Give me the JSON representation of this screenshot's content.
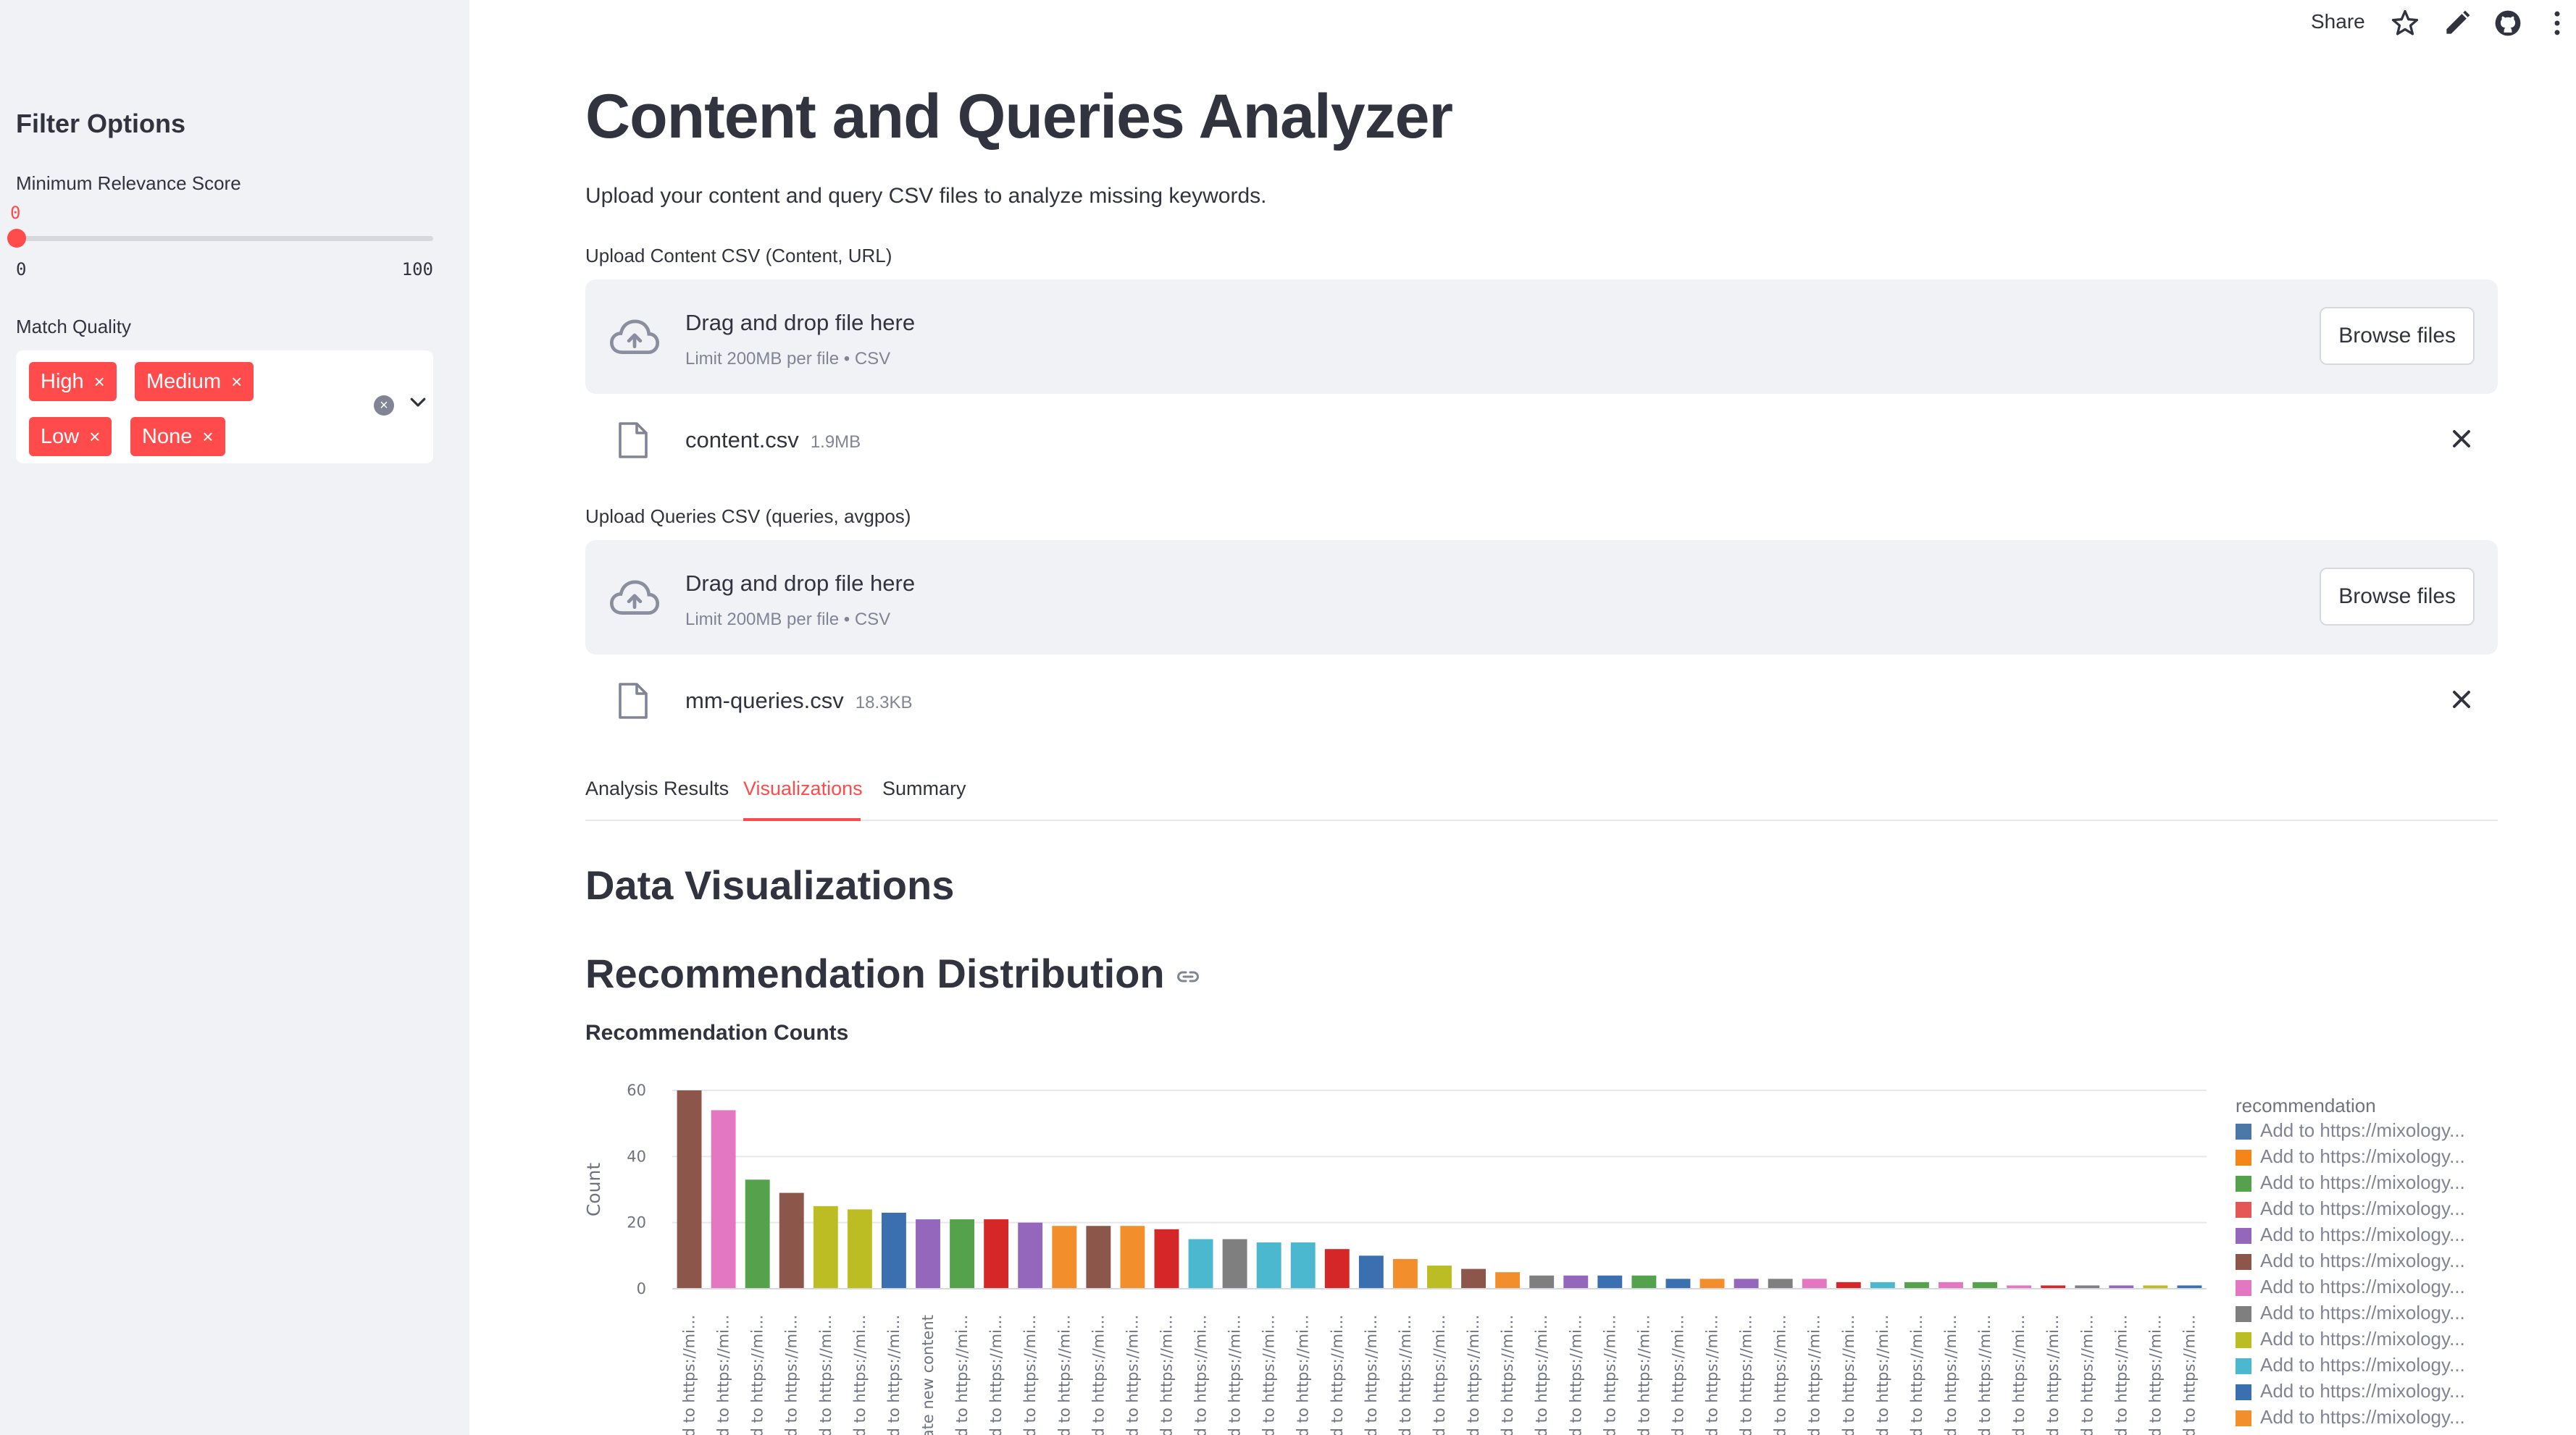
{
  "toolbar": {
    "share_label": "Share",
    "icons": [
      "star-icon",
      "edit-icon",
      "github-icon",
      "more-icon"
    ]
  },
  "sidebar": {
    "title": "Filter Options",
    "min_score": {
      "label": "Minimum Relevance Score",
      "value": "0",
      "min": "0",
      "max": "100"
    },
    "match_quality": {
      "label": "Match Quality",
      "chips": [
        "High",
        "Medium",
        "Low",
        "None"
      ],
      "chip_remove": "×"
    }
  },
  "main": {
    "title": "Content and Queries Analyzer",
    "intro": "Upload your content and query CSV files to analyze missing keywords.",
    "content_upload": {
      "label": "Upload Content CSV (Content, URL)",
      "drop_title": "Drag and drop file here",
      "drop_sub": "Limit 200MB per file • CSV",
      "browse": "Browse files",
      "file_name": "content.csv",
      "file_size": "1.9MB"
    },
    "queries_upload": {
      "label": "Upload Queries CSV (queries, avgpos)",
      "drop_title": "Drag and drop file here",
      "drop_sub": "Limit 200MB per file • CSV",
      "browse": "Browse files",
      "file_name": "mm-queries.csv",
      "file_size": "18.3KB"
    },
    "tabs": [
      {
        "label": "Analysis Results"
      },
      {
        "label": "Visualizations"
      },
      {
        "label": "Summary"
      }
    ],
    "active_tab": "Visualizations",
    "section_title": "Data Visualizations",
    "subsection_title": "Recommendation Distribution",
    "chart_title": "Recommendation Counts"
  },
  "legend": {
    "title": "recommendation",
    "items": [
      {
        "label": "Add to https://mixology...",
        "color": "#4c78a8"
      },
      {
        "label": "Add to https://mixology...",
        "color": "#f58518"
      },
      {
        "label": "Add to https://mixology...",
        "color": "#54a24b"
      },
      {
        "label": "Add to https://mixology...",
        "color": "#e45756"
      },
      {
        "label": "Add to https://mixology...",
        "color": "#9467bd"
      },
      {
        "label": "Add to https://mixology...",
        "color": "#8c564b"
      },
      {
        "label": "Add to https://mixology...",
        "color": "#e377c2"
      },
      {
        "label": "Add to https://mixology...",
        "color": "#7f7f7f"
      },
      {
        "label": "Add to https://mixology...",
        "color": "#bcbd22"
      },
      {
        "label": "Add to https://mixology...",
        "color": "#4bb8d0"
      },
      {
        "label": "Add to https://mixology...",
        "color": "#3a6fb0"
      },
      {
        "label": "Add to https://mixology...",
        "color": "#f28e2b"
      }
    ]
  },
  "chart_data": {
    "type": "bar",
    "title": "Recommendation Counts",
    "ylabel": "Count",
    "xlabel": "",
    "ylim": [
      0,
      60
    ],
    "yticks": [
      0,
      20,
      40,
      60
    ],
    "grid": true,
    "legend_title": "recommendation",
    "legend_position": "right",
    "categories": [
      "d to https://mi...",
      "d to https://mi...",
      "d to https://mi...",
      "d to https://mi...",
      "d to https://mi...",
      "d to https://mi...",
      "d to https://mi...",
      "eate new content",
      "d to https://mi...",
      "d to https://mi...",
      "d to https://mi...",
      "d to https://mi...",
      "d to https://mi...",
      "d to https://mi...",
      "d to https://mi...",
      "d to https://mi...",
      "d to https://mi...",
      "d to https://mi...",
      "d to https://mi...",
      "d to https://mi...",
      "d to https://mi...",
      "d to https://mi...",
      "d to https://mi...",
      "d to https://mi...",
      "d to https://mi...",
      "d to https://mi...",
      "d to https://mi...",
      "d to https://mi...",
      "d to https://mi...",
      "d to https://mi...",
      "d to https://mi...",
      "d to https://mi...",
      "d to https://mi...",
      "d to https://mi...",
      "d to https://mi...",
      "d to https://mi...",
      "d to https://mi...",
      "d to https://mi...",
      "d to https://mi...",
      "d to https://mi...",
      "d to https://mi...",
      "d to https://mi...",
      "d to https://mi...",
      "d to https://mi...",
      "d to https://mi..."
    ],
    "values": [
      60,
      54,
      33,
      29,
      25,
      24,
      23,
      21,
      21,
      21,
      20,
      19,
      19,
      19,
      18,
      15,
      15,
      14,
      14,
      12,
      10,
      9,
      7,
      6,
      5,
      4,
      4,
      4,
      4,
      3,
      3,
      3,
      3,
      3,
      2,
      2,
      2,
      2,
      2,
      1,
      1,
      1,
      1,
      1,
      1
    ],
    "colors": [
      "#8c564b",
      "#e377c2",
      "#54a24b",
      "#8c564b",
      "#bcbd22",
      "#bcbd22",
      "#3a6fb0",
      "#9467bd",
      "#54a24b",
      "#d62728",
      "#9467bd",
      "#f28e2b",
      "#8c564b",
      "#f28e2b",
      "#d62728",
      "#4bb8d0",
      "#7f7f7f",
      "#4bb8d0",
      "#4bb8d0",
      "#d62728",
      "#3a6fb0",
      "#f28e2b",
      "#bcbd22",
      "#8c564b",
      "#f28e2b",
      "#7f7f7f",
      "#9467bd",
      "#3a6fb0",
      "#54a24b",
      "#3a6fb0",
      "#f28e2b",
      "#9467bd",
      "#7f7f7f",
      "#e377c2",
      "#d62728",
      "#4bb8d0",
      "#54a24b",
      "#e377c2",
      "#54a24b",
      "#e377c2",
      "#d62728",
      "#7f7f7f",
      "#9467bd",
      "#bcbd22",
      "#3a6fb0"
    ]
  }
}
